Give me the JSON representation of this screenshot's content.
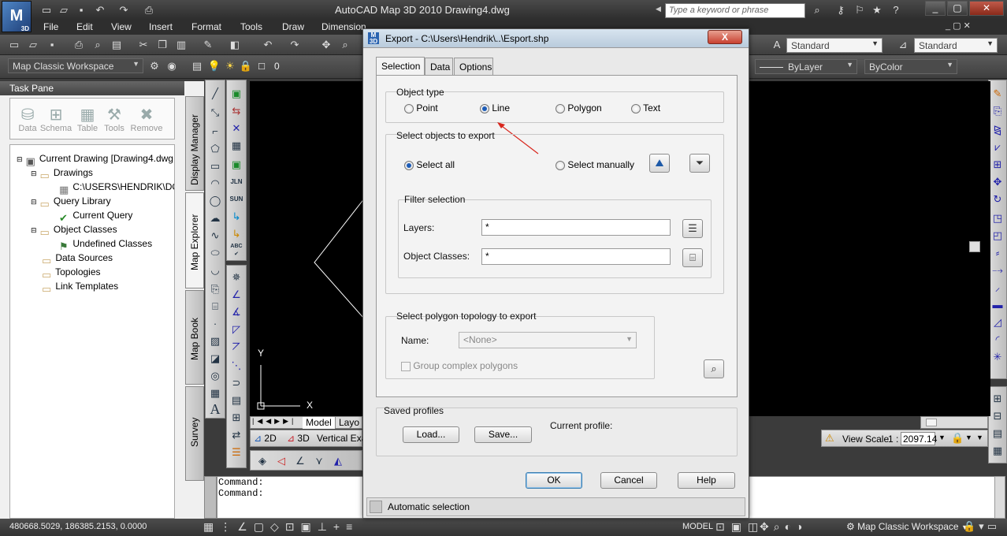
{
  "app": {
    "title": "AutoCAD Map 3D 2010    Drawing4.dwg",
    "logo_text": "M",
    "logo_sub": "3D",
    "search_placeholder": "Type a keyword or phrase"
  },
  "menu": [
    "File",
    "Edit",
    "View",
    "Insert",
    "Format",
    "Tools",
    "Draw",
    "Dimension"
  ],
  "toolbar": {
    "workspace": "Map Classic Workspace",
    "layer_value": "0",
    "text_style": "Standard",
    "dim_style": "Standard",
    "linetype": "ByLayer",
    "color": "ByColor"
  },
  "taskpane": {
    "title": "Task Pane",
    "tools": [
      "Data",
      "Schema",
      "Table",
      "Tools",
      "Remove"
    ],
    "tree": [
      {
        "label": "Current Drawing [Drawing4.dwg",
        "depth": 0,
        "icon": "drawing"
      },
      {
        "label": "Drawings",
        "depth": 1,
        "icon": "folder"
      },
      {
        "label": "C:\\USERS\\HENDRIK\\DO",
        "depth": 2,
        "icon": "map"
      },
      {
        "label": "Query Library",
        "depth": 1,
        "icon": "folder"
      },
      {
        "label": "Current Query",
        "depth": 2,
        "icon": "query"
      },
      {
        "label": "Object Classes",
        "depth": 1,
        "icon": "folder"
      },
      {
        "label": "Undefined Classes",
        "depth": 2,
        "icon": "class"
      },
      {
        "label": "Data Sources",
        "depth": 1,
        "icon": "folder"
      },
      {
        "label": "Topologies",
        "depth": 1,
        "icon": "folder"
      },
      {
        "label": "Link Templates",
        "depth": 1,
        "icon": "folder"
      }
    ],
    "side_tabs": [
      "Display Manager",
      "Map Explorer",
      "Map Book",
      "Survey"
    ]
  },
  "canvas": {
    "axis_y": "Y",
    "axis_x": "X",
    "tabs": [
      "Model",
      "Layo"
    ],
    "nav_2d": "2D",
    "nav_3d": "3D",
    "nav_vertical": "Vertical Exa",
    "view_scale_label": "View Scale",
    "view_scale_num": "1 :",
    "view_scale_value": "2097.14"
  },
  "command": {
    "lines": [
      "Command:",
      "Command:"
    ]
  },
  "status": {
    "coords": "480668.5029, 186385.2153, 0.0000",
    "model": "MODEL",
    "workspace": "Map Classic Workspace"
  },
  "dialog": {
    "title": "Export - C:\\Users\\Hendrik\\..\\Esport.shp",
    "close": "X",
    "tabs": [
      "Selection",
      "Data",
      "Options"
    ],
    "object_type_label": "Object type",
    "object_types": [
      "Point",
      "Line",
      "Polygon",
      "Text"
    ],
    "object_type_selected": "Line",
    "select_objects_label": "Select objects to export",
    "select_all": "Select all",
    "select_manually": "Select manually",
    "filter_label": "Filter selection",
    "layers_label": "Layers:",
    "layers_value": "*",
    "classes_label": "Object Classes:",
    "classes_value": "*",
    "topology_label": "Select polygon topology to export",
    "name_label": "Name:",
    "name_value": "<None>",
    "group_complex": "Group complex polygons",
    "saved_profiles": "Saved profiles",
    "load": "Load...",
    "save": "Save...",
    "current_profile": "Current profile:",
    "ok": "OK",
    "cancel": "Cancel",
    "help": "Help",
    "status": "Automatic selection"
  }
}
